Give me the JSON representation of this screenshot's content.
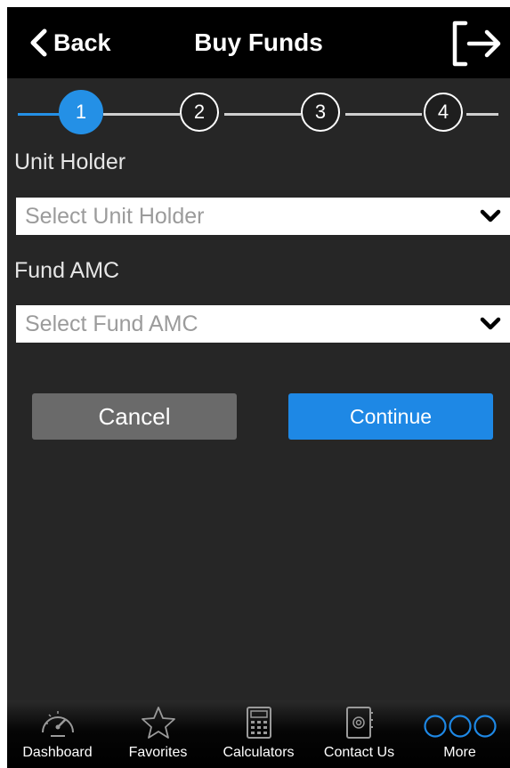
{
  "header": {
    "back_label": "Back",
    "title": "Buy Funds",
    "logout_icon": "logout-arrow-icon"
  },
  "stepper": {
    "current": 1,
    "steps": [
      "1",
      "2",
      "3",
      "4"
    ]
  },
  "form": {
    "unit_holder_label": "Unit Holder",
    "unit_holder_placeholder": "Select Unit Holder",
    "fund_amc_label": "Fund AMC",
    "fund_amc_placeholder": "Select Fund AMC"
  },
  "buttons": {
    "cancel": "Cancel",
    "continue": "Continue"
  },
  "tabbar": {
    "items": [
      {
        "label": "Dashboard",
        "icon": "speedometer-icon"
      },
      {
        "label": "Favorites",
        "icon": "star-icon"
      },
      {
        "label": "Calculators",
        "icon": "calculator-icon"
      },
      {
        "label": "Contact Us",
        "icon": "address-book-icon"
      },
      {
        "label": "More",
        "icon": "more-circles-icon"
      }
    ]
  },
  "colors": {
    "accent": "#2490e6",
    "background": "#262626",
    "header": "#000000",
    "cancel_button": "#6a6a6a",
    "continue_button": "#1e88e5"
  }
}
